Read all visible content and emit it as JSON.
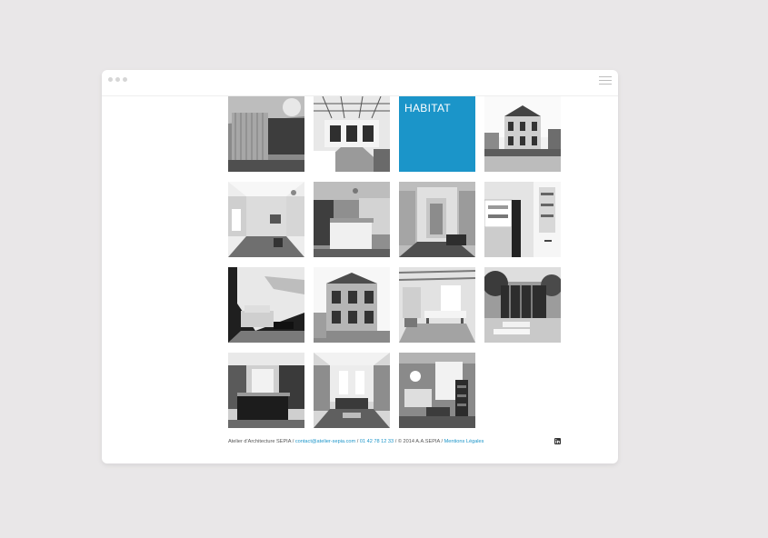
{
  "grid": {
    "category_label": "HABITAT"
  },
  "footer": {
    "company": "Atelier d'Architecture SEPIA",
    "sep1": " / ",
    "email": "contact@atelier-sepia.com",
    "sep2": " / ",
    "phone": "01 42 78 12 33",
    "sep3": " / ",
    "copyright": "© 2014 A.A.SEPIA",
    "sep4": " / ",
    "legal": "Mentions Légales"
  },
  "colors": {
    "accent": "#1b95c9",
    "background": "#e9e7e8"
  },
  "icons": {
    "social": "linkedin-icon",
    "menu": "hamburger-menu-icon"
  }
}
